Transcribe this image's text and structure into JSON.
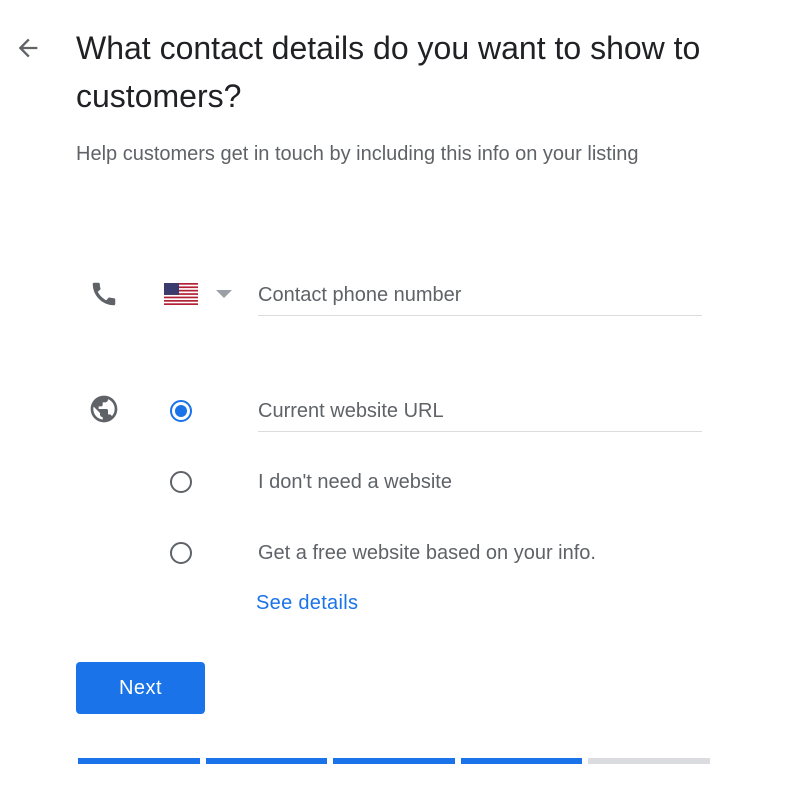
{
  "header": {
    "title": "What contact details do you want to show to customers?",
    "subtitle": "Help customers get in touch by including this info on your listing",
    "back_icon": "arrow-back-icon"
  },
  "phone": {
    "icon": "phone-icon",
    "country_flag": "us-flag-icon",
    "placeholder": "Contact phone number",
    "value": ""
  },
  "website": {
    "icon": "globe-icon",
    "options": [
      {
        "label": "",
        "input_placeholder": "Current website URL",
        "checked": true
      },
      {
        "label": "I don't need a website",
        "checked": false
      },
      {
        "label": "Get a free website based on your info.",
        "checked": false
      }
    ],
    "link_label": "See details"
  },
  "actions": {
    "next_label": "Next"
  },
  "progress": {
    "total_steps": 5,
    "completed_steps": 4
  },
  "colors": {
    "accent": "#1a73e8",
    "muted_text": "#5f6368",
    "divider": "#dadce0"
  }
}
